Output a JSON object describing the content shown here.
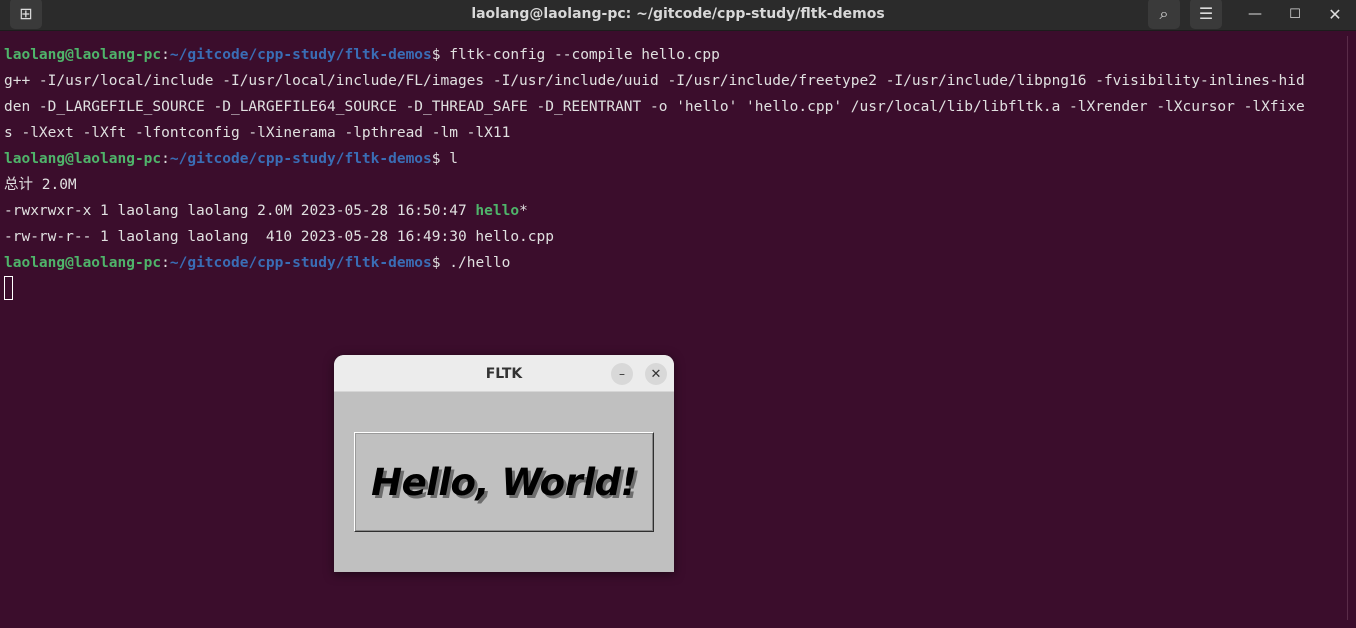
{
  "window": {
    "title": "laolang@laolang-pc: ~/gitcode/cpp-study/fltk-demos",
    "icons": {
      "new_tab": "new-tab-icon",
      "search": "search-icon",
      "menu": "hamburger-menu-icon",
      "minimize": "minimize-icon",
      "maximize": "maximize-icon",
      "close": "close-icon"
    },
    "glyphs": {
      "new_tab": "⊞",
      "search": "⌕",
      "menu": "☰",
      "minimize": "—",
      "maximize": "☐",
      "close": "✕"
    }
  },
  "terminal": {
    "prompt_user": "laolang@laolang-pc",
    "prompt_sep": ":",
    "prompt_path": "~/gitcode/cpp-study/fltk-demos",
    "prompt_dollar": "$ ",
    "cmd1": "fltk-config --compile hello.cpp",
    "out1_1": "g++ -I/usr/local/include -I/usr/local/include/FL/images -I/usr/include/uuid -I/usr/include/freetype2 -I/usr/include/libpng16 -fvisibility-inlines-hid",
    "out1_2": "den -D_LARGEFILE_SOURCE -D_LARGEFILE64_SOURCE -D_THREAD_SAFE -D_REENTRANT -o 'hello' 'hello.cpp' /usr/local/lib/libfltk.a -lXrender -lXcursor -lXfixe",
    "out1_3": "s -lXext -lXft -lfontconfig -lXinerama -lpthread -lm -lX11",
    "cmd2": "l",
    "total": "总计 2.0M",
    "ls1_prefix": "-rwxrwxr-x 1 laolang laolang 2.0M 2023-05-28 16:50:47 ",
    "ls1_name": "hello",
    "ls1_suffix": "*",
    "ls2": "-rw-rw-r-- 1 laolang laolang  410 2023-05-28 16:49:30 hello.cpp",
    "cmd3": "./hello"
  },
  "fltk_window": {
    "title": "FLTK",
    "min_glyph": "–",
    "close_glyph": "✕",
    "box_label": "Hello, World!"
  },
  "colors": {
    "terminal_bg": "#3b0d2c",
    "prompt_user": "#4fb46a",
    "prompt_path": "#3a6db5",
    "fltk_bg": "#c0c0c0"
  }
}
